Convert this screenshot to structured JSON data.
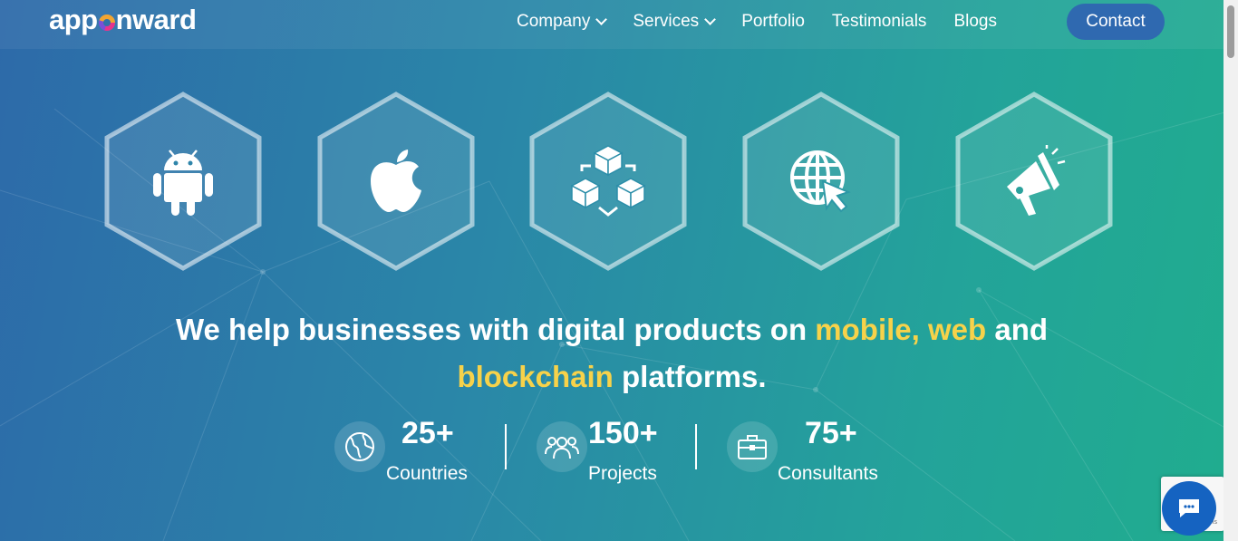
{
  "header": {
    "logo_text_left": "app",
    "logo_text_right": "nward",
    "nav": [
      {
        "label": "Company",
        "has_dropdown": true
      },
      {
        "label": "Services",
        "has_dropdown": true
      },
      {
        "label": "Portfolio",
        "has_dropdown": false
      },
      {
        "label": "Testimonials",
        "has_dropdown": false
      },
      {
        "label": "Blogs",
        "has_dropdown": false
      }
    ],
    "contact_label": "Contact"
  },
  "hexagons": [
    {
      "icon": "android-icon"
    },
    {
      "icon": "apple-icon"
    },
    {
      "icon": "blockchain-cubes-icon"
    },
    {
      "icon": "web-globe-cursor-icon"
    },
    {
      "icon": "megaphone-icon"
    }
  ],
  "headline": {
    "part1": "We help businesses with digital products on ",
    "hl1": "mobile, web",
    "part2": " and",
    "hl2": "blockchain",
    "part3": " platforms."
  },
  "stats": [
    {
      "value": "25+",
      "label": "Countries",
      "icon": "globe-icon"
    },
    {
      "value": "150+",
      "label": "Projects",
      "icon": "team-icon"
    },
    {
      "value": "75+",
      "label": "Consultants",
      "icon": "briefcase-icon"
    }
  ],
  "colors": {
    "highlight": "#f7d24a",
    "contact_button": "#2f69b0",
    "chat_button": "#1563c1"
  },
  "chat_widget": {
    "tiny_text": "ms"
  }
}
